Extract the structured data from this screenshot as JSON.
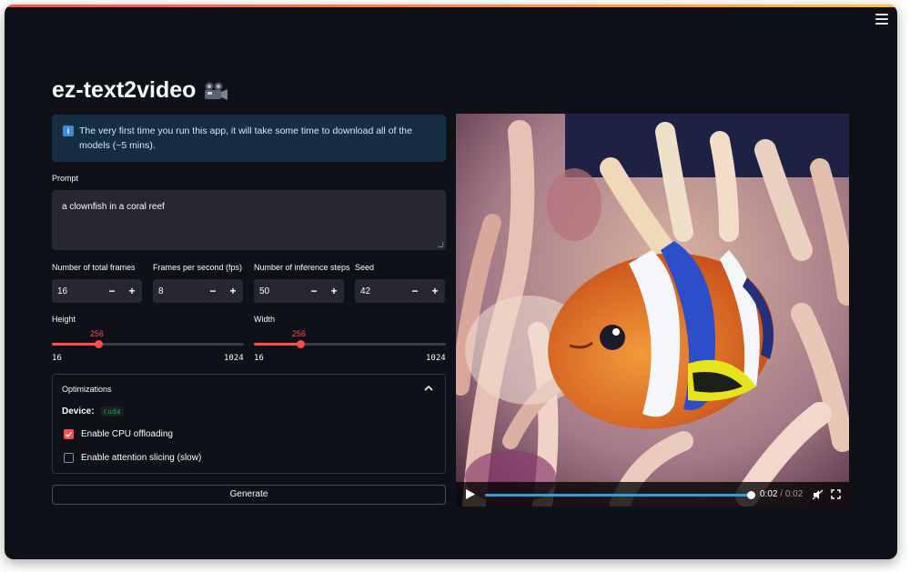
{
  "app": {
    "title": "ez-text2video",
    "title_icon": "movie-camera-icon"
  },
  "info": {
    "text": "The very first time you run this app, it will take some time to download all of the models (~5 mins).",
    "icon": "info-icon"
  },
  "prompt": {
    "label": "Prompt",
    "value": "a clownfish in a coral reef"
  },
  "number_inputs": [
    {
      "label": "Number of total frames",
      "value": "16"
    },
    {
      "label": "Frames per second (fps)",
      "value": "8"
    },
    {
      "label": "Number of inference steps",
      "value": "50"
    },
    {
      "label": "Seed",
      "value": "42"
    }
  ],
  "stepper": {
    "minus": "−",
    "plus": "+"
  },
  "sliders": [
    {
      "label": "Height",
      "value": "256",
      "min": "16",
      "max": "1024",
      "fraction": 0.24
    },
    {
      "label": "Width",
      "value": "256",
      "min": "16",
      "max": "1024",
      "fraction": 0.24
    }
  ],
  "optimizations": {
    "header": "Optimizations",
    "device_label": "Device:",
    "device_value": "cuda",
    "options": [
      {
        "label": "Enable CPU offloading",
        "checked": true
      },
      {
        "label": "Enable attention slicing (slow)",
        "checked": false
      }
    ]
  },
  "generate": {
    "label": "Generate"
  },
  "video": {
    "current": "0:02",
    "separator": " / ",
    "duration": "0:02",
    "progress": 1.0
  },
  "colors": {
    "accent": "#ff4b4b",
    "background": "#0e1117",
    "input_bg": "#262730",
    "info_bg": "#172d43",
    "seek": "#26a3e0"
  }
}
